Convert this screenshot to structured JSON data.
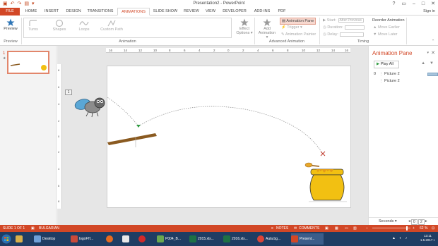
{
  "titlebar": {
    "title": "Presentation2 - PowerPoint",
    "qat": [
      "save-icon",
      "undo-icon",
      "redo-icon",
      "start-slideshow-icon",
      "customize-icon"
    ],
    "window_controls": [
      "?",
      "▭",
      "–",
      "□",
      "✕"
    ]
  },
  "tabs": [
    "FILE",
    "HOME",
    "INSERT",
    "DESIGN",
    "TRANSITIONS",
    "ANIMATIONS",
    "SLIDE SHOW",
    "REVIEW",
    "VIEW",
    "DEVELOPER",
    "ADD-INS",
    "PDF"
  ],
  "active_tab": "ANIMATIONS",
  "signin": "Sign in",
  "ribbon": {
    "preview_label": "Preview",
    "preview_group": "Preview",
    "effects": [
      "Turns",
      "Shapes",
      "Loops",
      "Custom Path"
    ],
    "animation_group": "Animation",
    "effect_options": "Effect Options ▾",
    "add_animation": "Add Animation ▾",
    "animation_pane": "Animation Pane",
    "trigger": "Trigger ▾",
    "animation_painter": "Animation Painter",
    "advanced_group": "Advanced Animation",
    "start_label": "Start:",
    "start_value": "After Previous",
    "duration_label": "Duration:",
    "delay_label": "Delay:",
    "reorder_label": "Reorder Animation",
    "move_earlier": "Move Earlier",
    "move_later": "Move Later",
    "timing_group": "Timing"
  },
  "thumbnails": {
    "number": "1",
    "star": "★"
  },
  "ruler": {
    "h": [
      "16",
      "14",
      "12",
      "10",
      "8",
      "6",
      "4",
      "2",
      "0",
      "2",
      "4",
      "6",
      "8",
      "10",
      "12",
      "14",
      "16"
    ],
    "v": [
      "8",
      "6",
      "4",
      "2",
      "0",
      "2",
      "4",
      "6",
      "8"
    ]
  },
  "slide": {
    "anim_tag": "1"
  },
  "animation_pane": {
    "title": "Animation Pane",
    "play_all": "Play All",
    "items": [
      {
        "num": "0",
        "name": "Picture 2",
        "bar_start": 0.0,
        "bar_len": 0.75
      },
      {
        "num": "",
        "name": "Picture 2",
        "bar_start": 0.8,
        "bar_len": 0.55
      }
    ],
    "seconds_label": "Seconds ▾",
    "zoom_value": "0",
    "zoom_alt": "2"
  },
  "statusbar": {
    "slide": "SLIDE 1 OF 1",
    "language": "BULGARIAN",
    "notes": "NOTES",
    "comments": "COMMENTS",
    "zoom": "62 %",
    "zoom_fraction": 0.62
  },
  "taskbar": {
    "buttons": [
      "Desktop",
      "logoFH...",
      "P004_B...",
      "2015.xls...",
      "2016.xls...",
      "Aula.bg...",
      "Present..."
    ],
    "time": "13:11",
    "date": "1.5.2017 г."
  },
  "colors": {
    "accent": "#d24726",
    "taskbar": "#1f3d63",
    "honey": "#f2c012",
    "fly_wing": "#5aa7d6"
  }
}
